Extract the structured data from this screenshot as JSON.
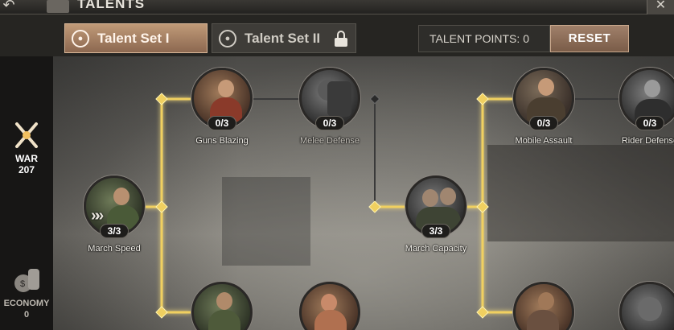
{
  "header": {
    "title": "TALENTS",
    "back_icon": "back-arrow-icon",
    "close_icon": "close-icon"
  },
  "tabs": [
    {
      "label": "Talent Set I",
      "active": true,
      "icon": "brain-head-icon"
    },
    {
      "label": "Talent Set II",
      "active": false,
      "icon": "brain-head-icon",
      "locked": true
    }
  ],
  "talent_points": {
    "label": "TALENT POINTS:",
    "value": "0"
  },
  "reset_label": "RESET",
  "sidebar": {
    "categories": [
      {
        "label": "WAR",
        "count": "207",
        "icon": "crossed-rifles-icon",
        "active": true
      },
      {
        "label": "ECONOMY",
        "count": "0",
        "icon": "money-bag-icon",
        "active": false
      }
    ]
  },
  "nodes": [
    {
      "name": "Guns Blazing",
      "level": "0/3"
    },
    {
      "name": "Melee Defense",
      "level": "0/3"
    },
    {
      "name": "Mobile Assault",
      "level": "0/3"
    },
    {
      "name": "Rider Defense",
      "level": "0/3"
    },
    {
      "name": "March Speed",
      "level": "3/3"
    },
    {
      "name": "March Capacity",
      "level": "3/3"
    }
  ],
  "colors": {
    "path_active": "#f0d060",
    "path_inactive": "#3a3a3a",
    "tab_active": "#a88064",
    "reset": "#8c6c56"
  }
}
